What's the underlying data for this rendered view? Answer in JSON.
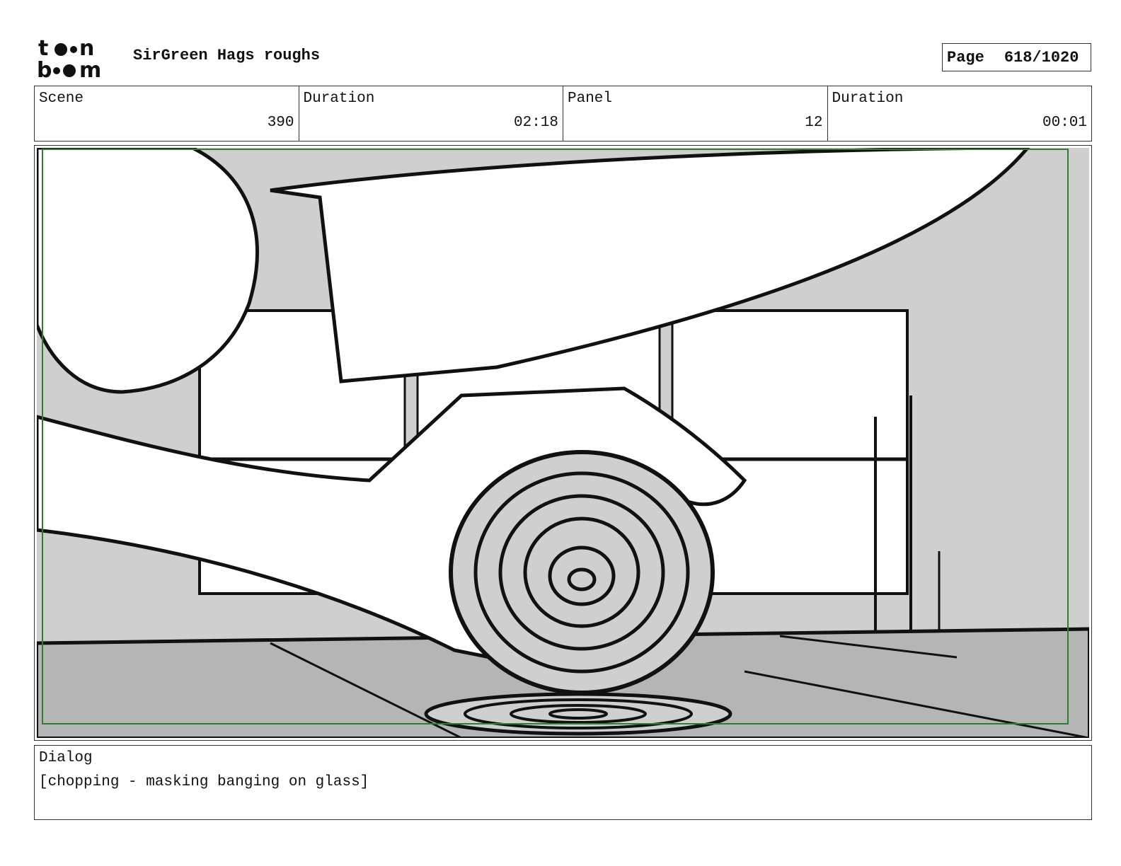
{
  "header": {
    "logo_text_top": "toon",
    "logo_text_bottom": "boom",
    "project_title": "SirGreen Hags roughs",
    "page_label": "Page",
    "page_number": "618/1020"
  },
  "info": {
    "scene_label": "Scene",
    "scene_value": "390",
    "scene_duration_label": "Duration",
    "scene_duration_value": "02:18",
    "panel_label": "Panel",
    "panel_value": "12",
    "panel_duration_label": "Duration",
    "panel_duration_value": "00:01"
  },
  "panel": {
    "image_description": "rough storyboard sketch: close-up of a knife chopping an onion on a cutting board, hands and window in background",
    "safe_area_color": "#2e7d32",
    "tone_light": "#cfcfcf",
    "tone_mid": "#b5b5b5"
  },
  "dialog": {
    "label": "Dialog",
    "text": "[chopping - masking banging on glass]"
  }
}
